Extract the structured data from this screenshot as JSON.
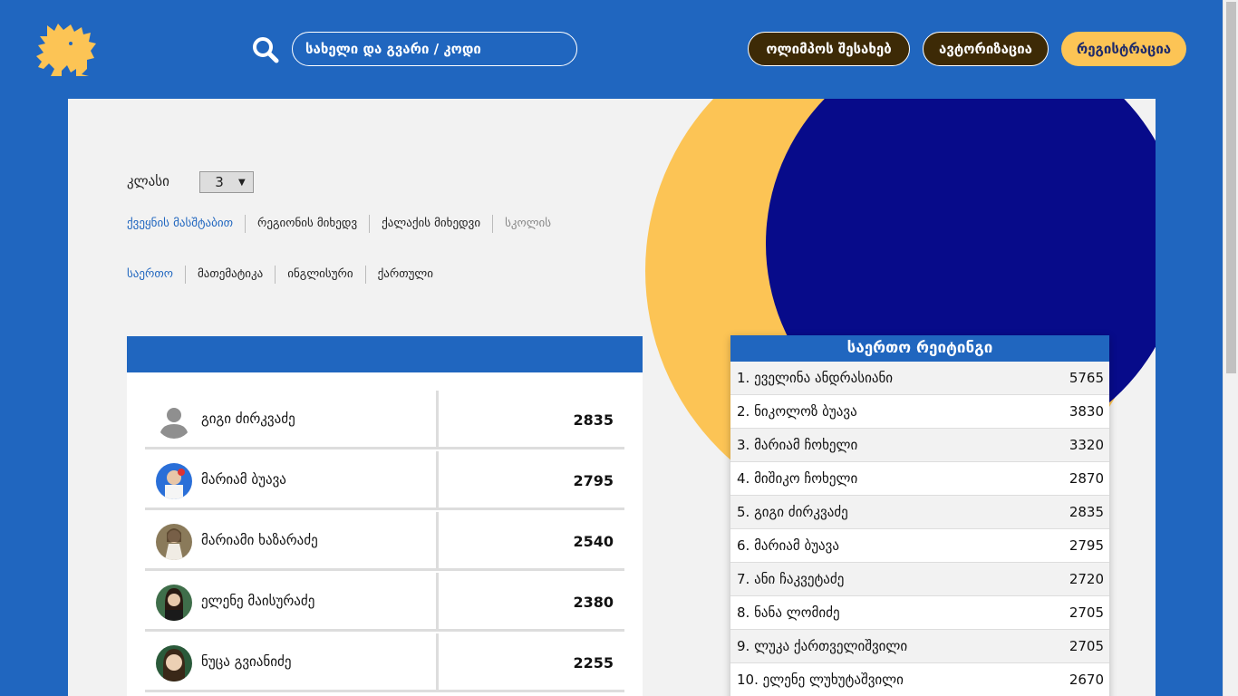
{
  "header": {
    "search_placeholder": "სახელი და გვარი / კოდი",
    "about_label": "ოლიმპოს შესახებ",
    "auth_label": "ავტორიზაცია",
    "register_label": "რეგისტრაცია"
  },
  "filters": {
    "class_label": "კლასი",
    "class_value": "3",
    "scope_tabs": [
      "ქვეყნის მასშტაბით",
      "რეგიონის მიხედვ",
      "ქალაქის მიხედვი",
      "სკოლის"
    ],
    "subject_tabs": [
      "საერთო",
      "მათემატიკა",
      "ინგლისური",
      "ქართული"
    ]
  },
  "results": [
    {
      "name": "გიგი ძირკვაძე",
      "score": "2835",
      "avatar": "default-avatar-icon"
    },
    {
      "name": "მარიამ ბუავა",
      "score": "2795",
      "avatar": "photo"
    },
    {
      "name": "მარიამი ხაზარაძე",
      "score": "2540",
      "avatar": "photo"
    },
    {
      "name": "ელენე მაისურაძე",
      "score": "2380",
      "avatar": "photo"
    },
    {
      "name": "ნუცა გვიანიძე",
      "score": "2255",
      "avatar": "photo"
    }
  ],
  "ranking": {
    "title": "საერთო რეიტინგი",
    "rows": [
      {
        "name": "1. ეველინა ანდრასიანი",
        "score": "5765"
      },
      {
        "name": "2. ნიკოლოზ ბუავა",
        "score": "3830"
      },
      {
        "name": "3. მარიამ ჩოხელი",
        "score": "3320"
      },
      {
        "name": "4. მიშიკო ჩოხელი",
        "score": "2870"
      },
      {
        "name": "5. გიგი ძირკვაძე",
        "score": "2835"
      },
      {
        "name": "6. მარიამ ბუავა",
        "score": "2795"
      },
      {
        "name": "7. ანი ჩაკვეტაძე",
        "score": "2720"
      },
      {
        "name": "8. ნანა ლომიძე",
        "score": "2705"
      },
      {
        "name": "9. ლუკა ქართველიშვილი",
        "score": "2705"
      },
      {
        "name": "10. ელენე ლუხუტაშვილი",
        "score": "2670"
      }
    ]
  },
  "colors": {
    "brand_blue": "#2066bf",
    "dark_navy": "#070b8a",
    "accent_yellow": "#fcc455",
    "dark_button": "#3d2a06"
  }
}
